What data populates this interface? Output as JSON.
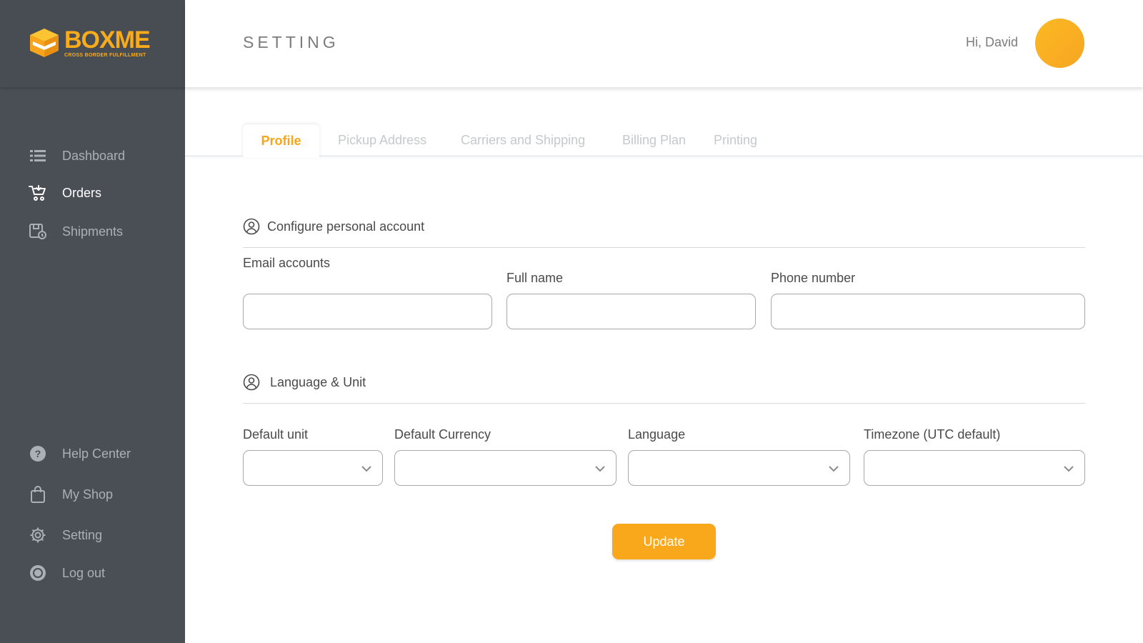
{
  "brand": {
    "name": "BOXME",
    "tagline": "CROSS BORDER FULFILLMENT",
    "accent_color": "#f9a81c"
  },
  "sidebar": {
    "items": [
      {
        "label": "Dashboard",
        "icon": "dashboard-icon"
      },
      {
        "label": "Orders",
        "icon": "cart-icon",
        "active": true
      },
      {
        "label": "Shipments",
        "icon": "shipments-icon"
      },
      {
        "label": "Help Center",
        "icon": "help-icon"
      },
      {
        "label": "My Shop",
        "icon": "shopping-bag-icon"
      },
      {
        "label": "Setting",
        "icon": "gear-icon"
      },
      {
        "label": "Log out",
        "icon": "power-icon"
      }
    ]
  },
  "header": {
    "title": "SETTING",
    "greeting": "Hi, David"
  },
  "tabs": [
    {
      "label": "Profile",
      "active": true
    },
    {
      "label": "Pickup Address"
    },
    {
      "label": "Carriers and Shipping"
    },
    {
      "label": "Billing Plan"
    },
    {
      "label": "Printing"
    }
  ],
  "personal": {
    "heading": "Configure personal account",
    "email_label": "Email accounts",
    "email_value": "",
    "fullname_label": "Full name",
    "fullname_value": "",
    "phone_label": "Phone number",
    "phone_value": ""
  },
  "language_unit": {
    "heading": "Language & Unit",
    "unit_label": "Default unit",
    "currency_label": "Default Currency",
    "language_label": "Language",
    "timezone_label": "Timezone (UTC default)"
  },
  "actions": {
    "update_label": "Update"
  }
}
